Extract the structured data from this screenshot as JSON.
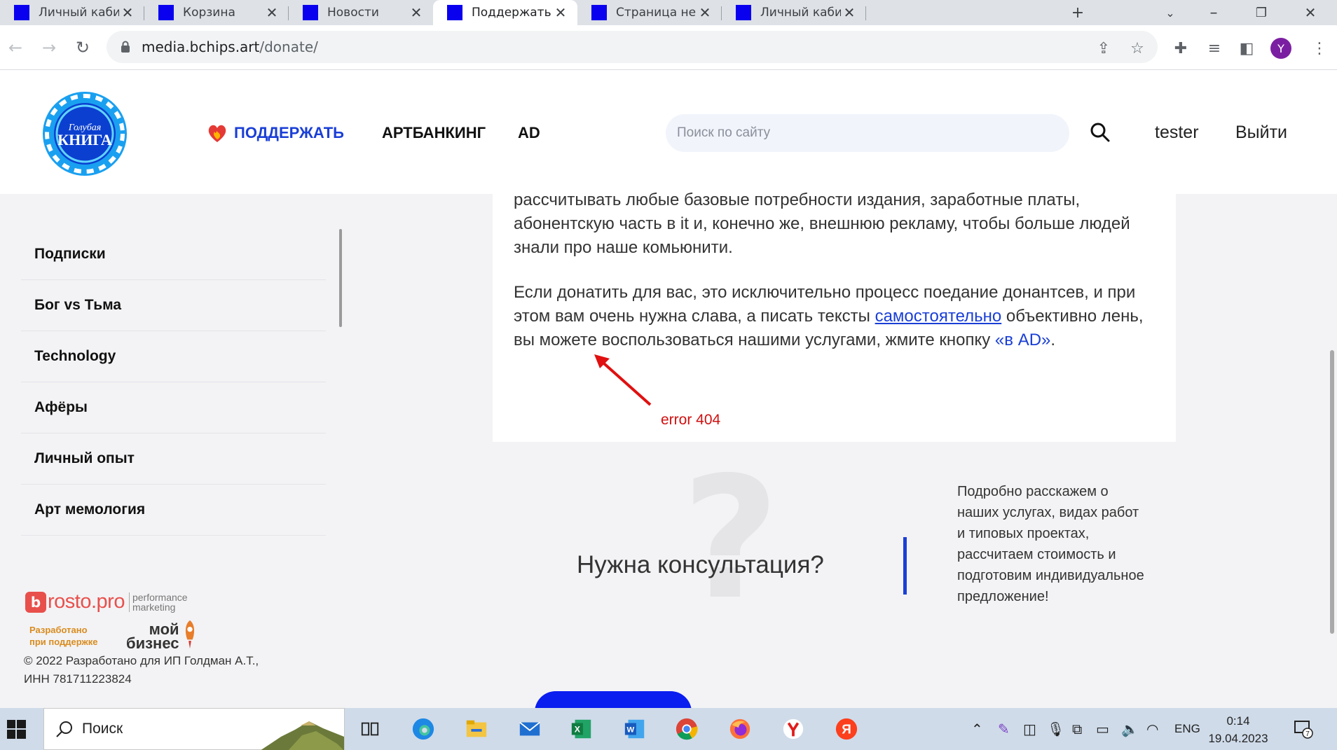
{
  "browser": {
    "tabs": [
      {
        "label": "Личный кабинет",
        "active": false
      },
      {
        "label": "Корзина",
        "active": false
      },
      {
        "label": "Новости",
        "active": false
      },
      {
        "label": "Поддержать",
        "active": true
      },
      {
        "label": "Страница не найд",
        "active": false
      },
      {
        "label": "Личный кабинет",
        "active": false
      }
    ],
    "new_tab_symbol": "+",
    "url_host": "media.bchips.art",
    "url_path": "/donate/",
    "profile_initial": "Y",
    "favicon_color": "#0a00f0"
  },
  "header": {
    "logo_text": "Голубая КНИГА",
    "nav": {
      "support": "ПОДДЕРЖАТЬ",
      "artbanking": "АРТБАНКИНГ",
      "ad": "AD"
    },
    "search_placeholder": "Поиск по сайту",
    "user": "tester",
    "logout": "Выйти"
  },
  "sidebar": {
    "items": [
      {
        "label": "Подписки"
      },
      {
        "label": "Бог vs Тьма"
      },
      {
        "label": "Technology"
      },
      {
        "label": "Афёры"
      },
      {
        "label": "Личный опыт"
      },
      {
        "label": "Арт мемология"
      }
    ],
    "partner_rosto": "rosto.pro",
    "partner_rosto_sub1": "performance",
    "partner_rosto_sub2": "marketing",
    "support_note_1": "Разработано",
    "support_note_2": "при поддержке",
    "partner_mybiz_1": "мой",
    "partner_mybiz_2": "бизнес",
    "copyright_line1": "© 2022 Разработано для ИП Голдман А.Т.,",
    "copyright_line2": "ИНН 781711223824"
  },
  "article": {
    "p1": "рассчитывать любые базовые потребности издания, заработные платы, абонентскую часть в it и, конечно же, внешнюю рекламу, чтобы больше людей знали про наше комьюнити.",
    "p2_part1": "Если донатить для вас, это исключительно процесс поедание донантсев, и при этом вам очень нужна слава, а писать тексты",
    "p2_link": "самостоятельно",
    "p2_part2": "объективно лень, вы можете воспользоваться нашими услугами, жмите кнопку",
    "p2_link2": "«в AD»",
    "p2_end": "."
  },
  "annotation": {
    "text": "error 404",
    "color": "#d01010"
  },
  "consult": {
    "title": "Нужна консультация?",
    "text": "Подробно расскажем о наших услугах, видах работ и типовых проектах, рассчитаем стоимость и подготовим индивидуальное предложение!",
    "accent": "#1a3fd6"
  },
  "taskbar": {
    "search_label": "Поиск",
    "lang": "ENG",
    "time": "0:14",
    "date": "19.04.2023",
    "notifications": "7"
  }
}
